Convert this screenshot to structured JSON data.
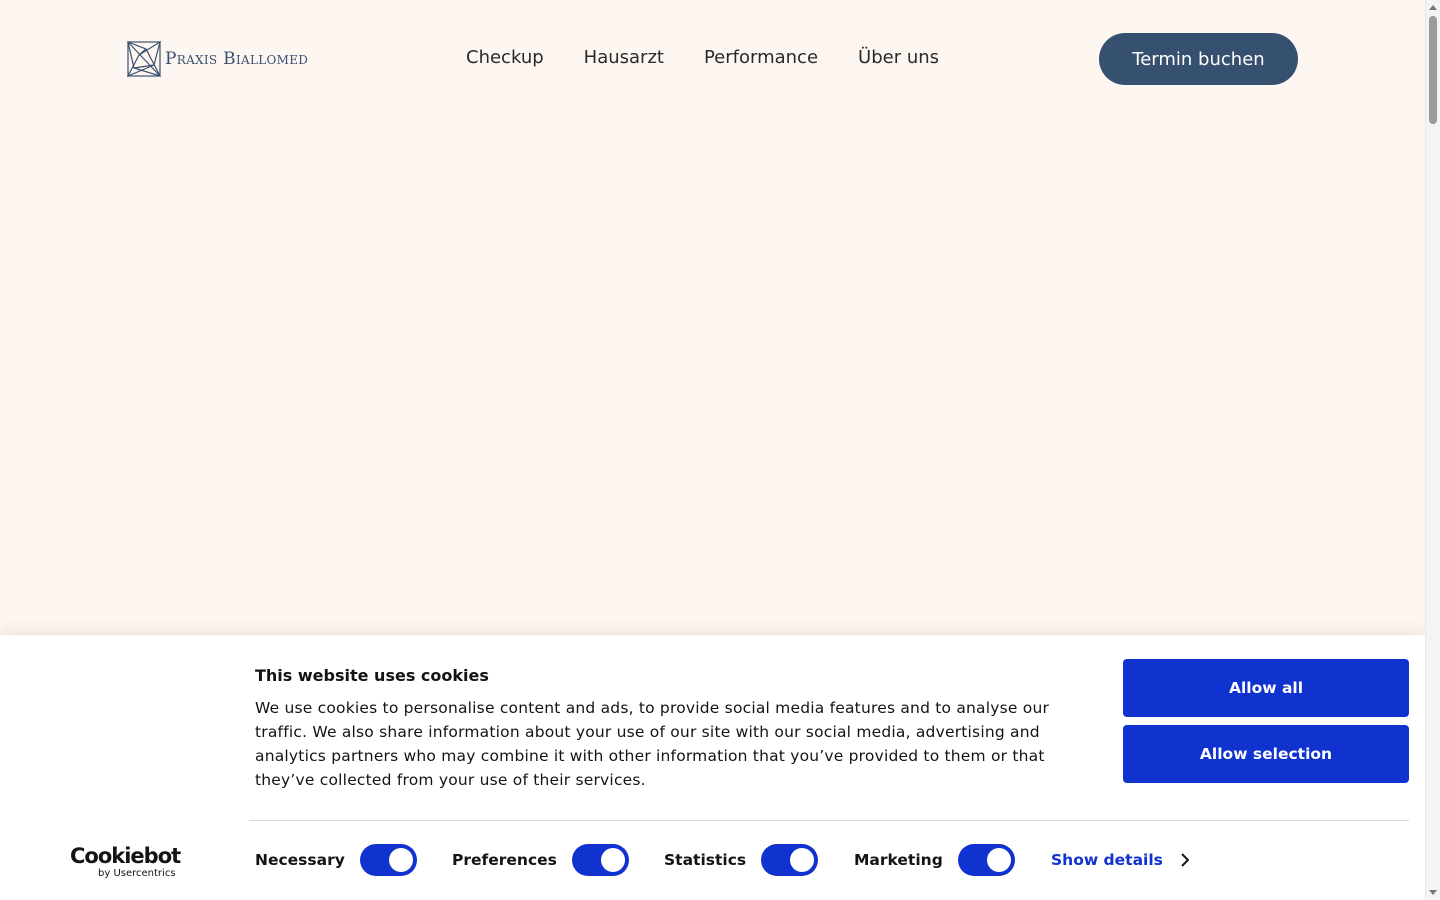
{
  "brand": {
    "name": "Praxis Biallomed",
    "color": "#36506f"
  },
  "nav": {
    "items": [
      {
        "label": "Checkup"
      },
      {
        "label": "Hausarzt"
      },
      {
        "label": "Performance"
      },
      {
        "label": "Über uns"
      }
    ],
    "cta_label": "Termin buchen"
  },
  "cookie_banner": {
    "title": "This website uses cookies",
    "text": "We use cookies to personalise content and ads, to provide social media features and to analyse our traffic. We also share information about your use of our site with our social media, advertising and analytics partners who may combine it with other information that you’ve provided to them or that they’ve collected from your use of their services.",
    "allow_all_label": "Allow all",
    "allow_selection_label": "Allow selection",
    "accent_color": "#1032cf",
    "provider": {
      "name": "Cookiebot",
      "sub": "by Usercentrics"
    },
    "toggles": [
      {
        "label": "Necessary",
        "checked": true
      },
      {
        "label": "Preferences",
        "checked": true
      },
      {
        "label": "Statistics",
        "checked": true
      },
      {
        "label": "Marketing",
        "checked": true
      }
    ],
    "show_details_label": "Show details"
  },
  "icons": {
    "logo": "geometric-polygon-logo-icon",
    "chevron": "chevron-right-icon"
  }
}
